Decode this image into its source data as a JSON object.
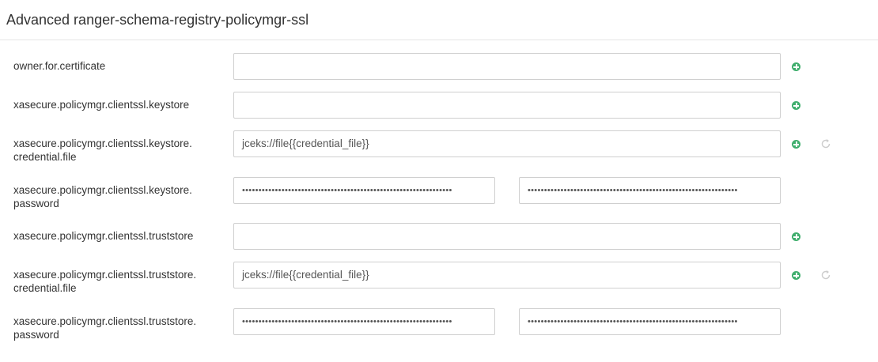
{
  "panel": {
    "title": "Advanced ranger-schema-registry-policymgr-ssl"
  },
  "rows": [
    {
      "label": "owner.for.certificate",
      "value": ""
    },
    {
      "label": "xasecure.policymgr.clientssl.keystore",
      "value": ""
    },
    {
      "label_line1": "xasecure.policymgr.clientssl.keystore.",
      "label_line2": "credential.file",
      "value": "jceks://file{{credential_file}}"
    },
    {
      "label_line1": "xasecure.policymgr.clientssl.keystore.",
      "label_line2": "password",
      "password": "••••••••••••••••••••••••••••••••••••••••••••••••••••••••••••••••",
      "confirm": "••••••••••••••••••••••••••••••••••••••••••••••••••••••••••••••••"
    },
    {
      "label": "xasecure.policymgr.clientssl.truststore",
      "value": ""
    },
    {
      "label_line1": "xasecure.policymgr.clientssl.truststore.",
      "label_line2": "credential.file",
      "value": "jceks://file{{credential_file}}"
    },
    {
      "label_line1": "xasecure.policymgr.clientssl.truststore.",
      "label_line2": "password",
      "password": "••••••••••••••••••••••••••••••••••••••••••••••••••••••••••••••••",
      "confirm": "••••••••••••••••••••••••••••••••••••••••••••••••••••••••••••••••"
    }
  ],
  "icons": {
    "add": "plus-circle-icon",
    "undo": "undo-icon",
    "add_color": "#3fae6d",
    "undo_color": "#cccccc"
  }
}
